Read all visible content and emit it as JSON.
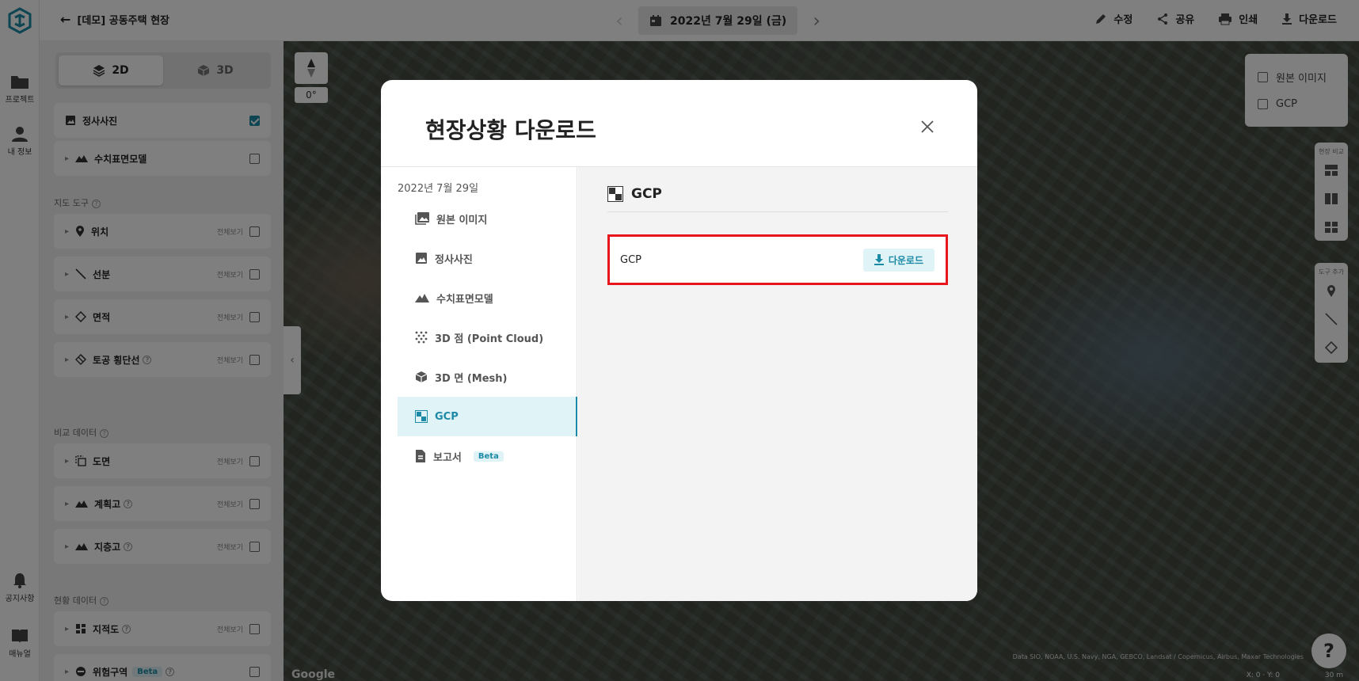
{
  "project": {
    "back_title": "[데모] 공동주택 현장"
  },
  "rail": {
    "projects": "프로젝트",
    "my_info": "내 정보",
    "notice": "공지사항",
    "manual": "매뉴얼"
  },
  "date_nav": {
    "date": "2022년 7월 29일 (금)"
  },
  "actions": {
    "edit": "수정",
    "share": "공유",
    "print": "인쇄",
    "download": "다운로드"
  },
  "view_toggle": {
    "opt_2d": "2D",
    "opt_3d": "3D",
    "selected": "2D"
  },
  "layers": {
    "ortho": "정사사진",
    "dsm": "수치표면모델"
  },
  "map_tools": {
    "section": "지도 도구",
    "view_all": "전체보기",
    "items": [
      "위치",
      "선분",
      "면적",
      "토공 횡단선"
    ]
  },
  "compare_data": {
    "section": "비교 데이터",
    "items": [
      "도면",
      "계획고",
      "지층고"
    ]
  },
  "current_data": {
    "section": "현황 데이터",
    "items": [
      "지적도",
      "위험구역"
    ],
    "beta": "Beta"
  },
  "map": {
    "degree": "0°",
    "layer_box": [
      "원본 이미지",
      "GCP"
    ],
    "compare_label": "현장 비교",
    "tool_add_label": "도구 추가",
    "google": "Google",
    "attribution": "Data SIO, NOAA, U.S. Navy, NGA, GEBCO, Landsat / Copernicus, Airbus, Maxar Technologies",
    "coords": "X: 0 · Y: 0",
    "scale": "30 m",
    "help": "?"
  },
  "modal": {
    "title": "현장상황 다운로드",
    "date": "2022년 7월 29일",
    "menu": [
      "원본 이미지",
      "정사사진",
      "수치표면모델",
      "3D 점 (Point Cloud)",
      "3D 면 (Mesh)",
      "GCP",
      "보고서"
    ],
    "selected": "GCP",
    "beta": "Beta",
    "section_title": "GCP",
    "file_name": "GCP",
    "download_label": "다운로드"
  },
  "colors": {
    "accent": "#1c8aa6",
    "highlight_border": "#e8151d"
  }
}
